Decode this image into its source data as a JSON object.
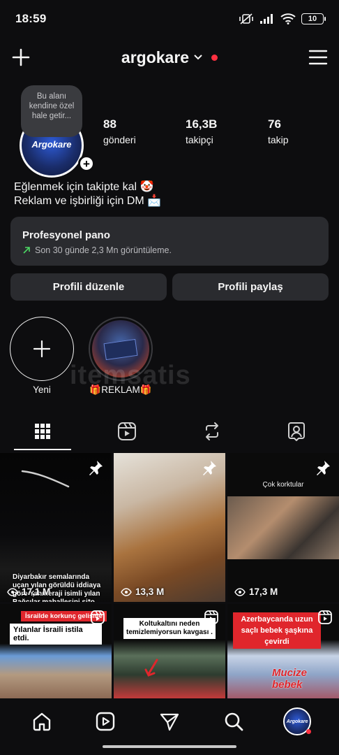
{
  "status_bar": {
    "time": "18:59",
    "battery": "10"
  },
  "header": {
    "username": "argokare"
  },
  "profile": {
    "note": "Bu alanı kendine özel hale getir...",
    "avatar_text": "Argokare",
    "stats": [
      {
        "num": "88",
        "label": "gönderi"
      },
      {
        "num": "16,3B",
        "label": "takipçi"
      },
      {
        "num": "76",
        "label": "takip"
      }
    ],
    "bio_line1": "Eğlenmek için takipte kal 🤡",
    "bio_line2": "Reklam ve işbirliği için DM 📩"
  },
  "dashboard": {
    "title": "Profesyonel pano",
    "subtitle": "Son 30 günde 2,3 Mn görüntüleme."
  },
  "buttons": {
    "edit": "Profili düzenle",
    "share": "Profili paylaş"
  },
  "highlights": [
    {
      "label": "Yeni"
    },
    {
      "label": "🎁REKLAM🎁"
    }
  ],
  "watermark": "itemsatis",
  "grid": [
    {
      "caption": "Diyarbakır semalarında uçan yılan görüldü iddiaya göre Yahmeraji isimli yılan Bağcılar mahallesini si*o süpürecekmiş",
      "views": "17,1 M",
      "pinned": true
    },
    {
      "views": "13,3 M",
      "pinned": true
    },
    {
      "top_text": "Çok korktular",
      "views": "17,3 M",
      "pinned": true
    },
    {
      "banner": "İsrailde korkunç gelişme",
      "caption": "Yılanlar İsraili istila etdi."
    },
    {
      "caption": "Koltukaltını neden temizlemiyorsun kavgası ."
    },
    {
      "banner": "Azerbaycanda uzun saçlı bebek şaşkına çevirdi",
      "overlay": "Mucize bebek"
    }
  ],
  "colors": {
    "background": "#0d0d0f",
    "card": "#2a2b2f",
    "accent_red": "#ff3040",
    "growth_green": "#4cd964"
  }
}
